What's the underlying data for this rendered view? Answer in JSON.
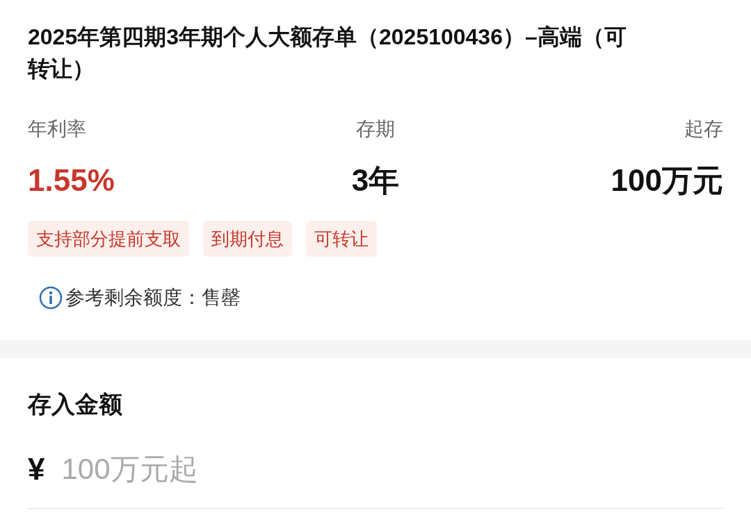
{
  "product": {
    "title": "2025年第四期3年期个人大额存单（2025100436）–高端（可转让）",
    "stats": [
      {
        "label": "年利率",
        "value": "1.55%",
        "kind": "rate"
      },
      {
        "label": "存期",
        "value": "3年",
        "kind": "plain"
      },
      {
        "label": "起存",
        "value": "100万元",
        "kind": "plain"
      }
    ],
    "tags": [
      "支持部分提前支取",
      "到期付息",
      "可转让"
    ],
    "quota": "参考剩余额度：售罄"
  },
  "deposit": {
    "heading": "存入金额",
    "currency": "¥",
    "placeholder": "100万元起"
  }
}
